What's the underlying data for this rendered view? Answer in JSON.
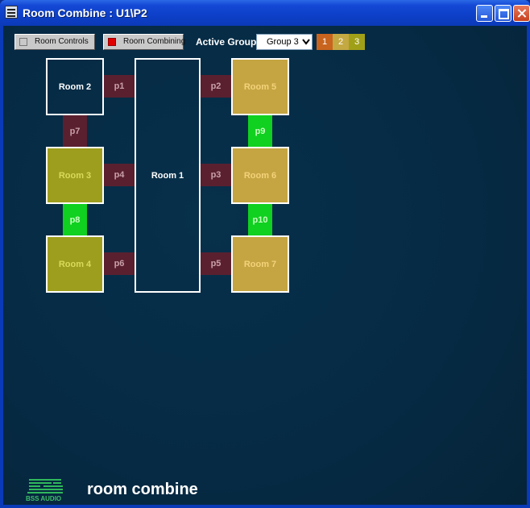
{
  "window": {
    "title": "Room Combine : U1\\P2"
  },
  "toolbar": {
    "room_controls_label": "Room Controls",
    "room_combining_label": "Room Combining",
    "active_group_label": "Active Group",
    "active_group_value": "Group 3",
    "group_buttons": [
      "1",
      "2",
      "3"
    ]
  },
  "rooms": {
    "room1": "Room 1",
    "room2": "Room 2",
    "room3": "Room 3",
    "room4": "Room 4",
    "room5": "Room 5",
    "room6": "Room 6",
    "room7": "Room 7"
  },
  "partitions": {
    "p1": "p1",
    "p2": "p2",
    "p3": "p3",
    "p4": "p4",
    "p5": "p5",
    "p6": "p6",
    "p7": "p7",
    "p8": "p8",
    "p9": "p9",
    "p10": "p10"
  },
  "footer": {
    "logo_text": "BSS AUDIO",
    "brand": "room combine"
  },
  "colors": {
    "background": "#062a44",
    "partition_open": "#5a2030",
    "partition_closed": "#10d020",
    "group1": "#c8641e",
    "group2": "#c4a842",
    "group3": "#a0a018",
    "combine_led": "#e00000"
  }
}
